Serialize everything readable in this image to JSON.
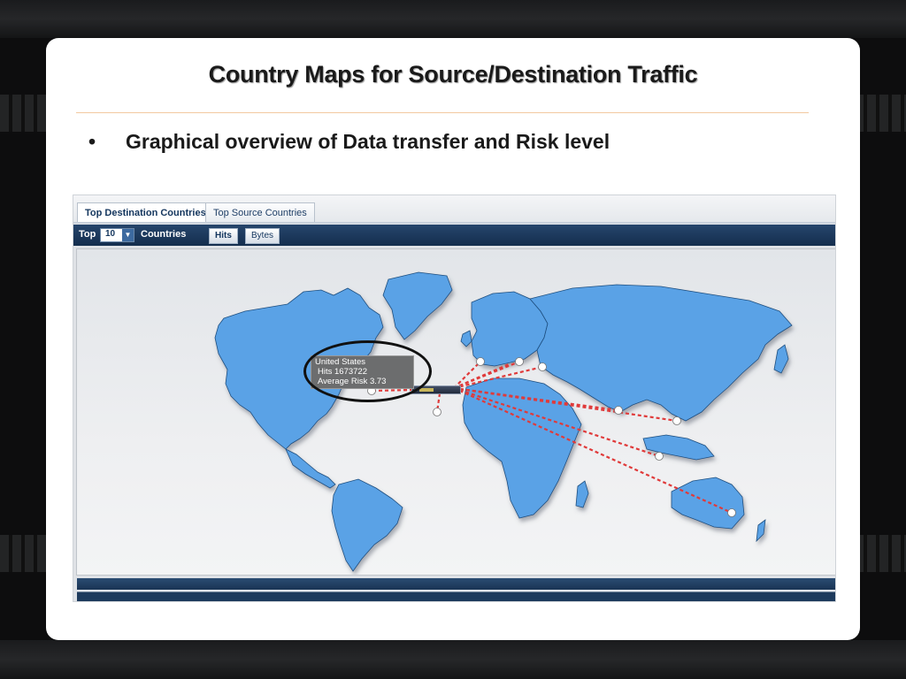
{
  "slide": {
    "title": "Country Maps for Source/Destination Traffic",
    "bullet": "Graphical overview of Data transfer and Risk level",
    "bullet_marker": "•"
  },
  "app": {
    "tabs": [
      {
        "label": "Top Destination Countries",
        "active": true
      },
      {
        "label": "Top Source Countries",
        "active": false
      }
    ],
    "toolbar": {
      "top_label": "Top",
      "count_value": "10",
      "countries_label": "Countries",
      "metric_buttons": [
        {
          "label": "Hits",
          "active": true
        },
        {
          "label": "Bytes",
          "active": false
        }
      ]
    },
    "tooltip": {
      "country": "United States",
      "hits_line": "Hits 1673722",
      "risk_line": "Average Risk 3.73"
    }
  },
  "colors": {
    "land": "#5aa2e6",
    "land_edge": "#1f4f80",
    "link": "#e03a3a",
    "toolbar": "#1b3656"
  },
  "icons": {
    "dropdown": "chevron-down-icon",
    "origin": "server-hub-icon",
    "endpoint": "location-dot-icon"
  }
}
